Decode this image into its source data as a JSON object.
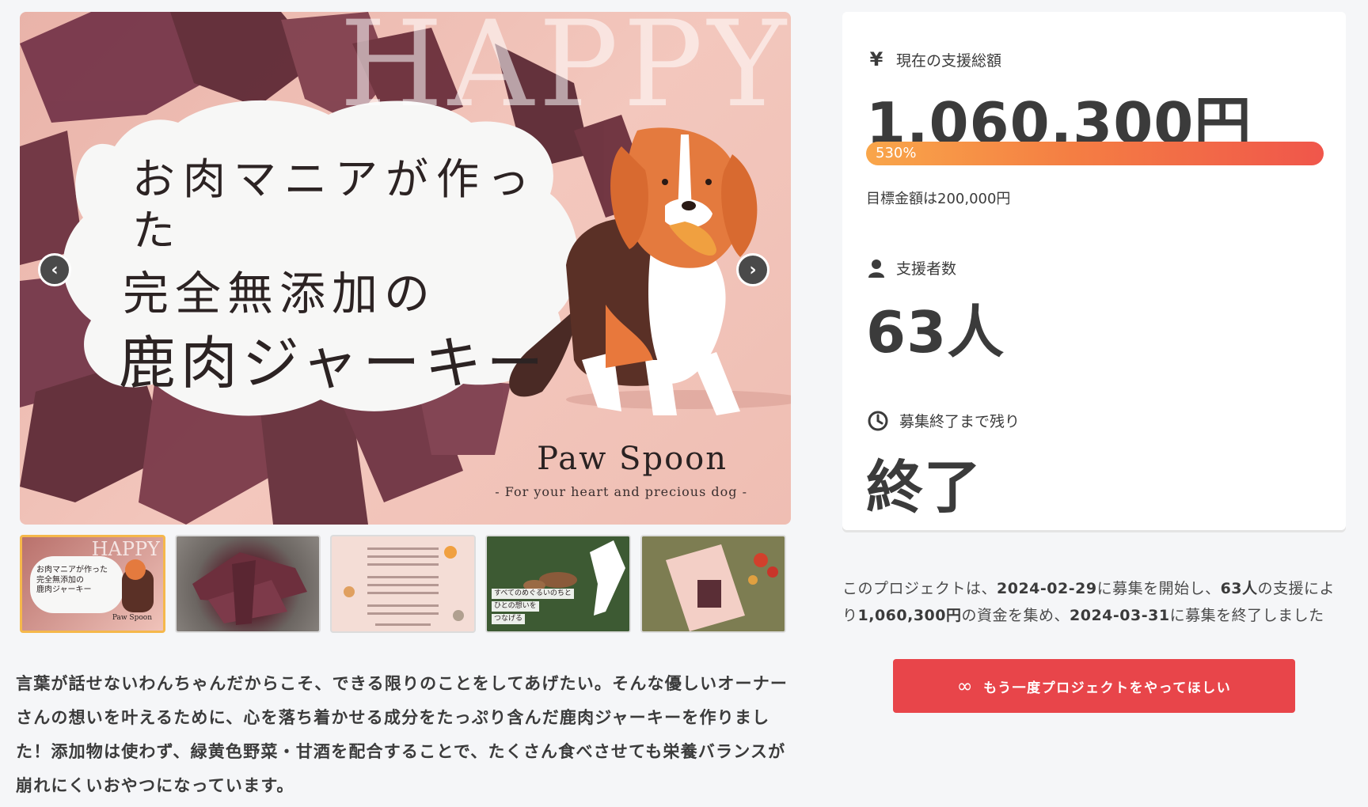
{
  "hero": {
    "happy_text": "HAPPY",
    "headline_line1": "お肉マニアが作った",
    "headline_line2": "完全無添加の",
    "headline_line3": "鹿肉ジャーキー",
    "brand": "Paw Spoon",
    "tagline": "- For your heart and precious dog -",
    "prev_icon": "chevron-left-icon",
    "next_icon": "chevron-right-icon"
  },
  "thumbnails": [
    {
      "id": "thumb-1",
      "happy": "HAPPY",
      "text": "お肉マニアが作った\n完全無添加の\n鹿肉ジャーキー",
      "brand": "Paw Spoon",
      "active": true
    },
    {
      "id": "thumb-2",
      "active": false
    },
    {
      "id": "thumb-3",
      "active": false
    },
    {
      "id": "thumb-4",
      "text1": "すべてのめぐるいのちと",
      "text2": "ひとの想いを",
      "text3": "つなげる",
      "active": false
    },
    {
      "id": "thumb-5",
      "active": false
    }
  ],
  "description": "言葉が話せないわんちゃんだからこそ、できる限りのことをしてあげたい。そんな優しいオーナーさんの想いを叶えるために、心を落ち着かせる成分をたっぷり含んだ鹿肉ジャーキーを作りました！添加物は使わず、緑黄色野菜・甘酒を配合することで、たくさん食べさせても栄養バランスが崩れにくいおやつになっています。",
  "stats": {
    "amount_icon": "yen-icon",
    "amount_label": "現在の支援総額",
    "amount_value": "1,060,300円",
    "progress_percent": 530,
    "progress_label": "530%",
    "goal_text": "目標金額は200,000円",
    "supporters_icon": "person-icon",
    "supporters_label": "支援者数",
    "supporters_value": "63人",
    "remaining_icon": "clock-icon",
    "remaining_label": "募集終了まで残り",
    "remaining_value": "終了"
  },
  "summary": {
    "part1": "このプロジェクトは、",
    "start_date": "2024-02-29",
    "part2": "に募集を開始し、",
    "supporters": "63人",
    "part3": "の支援により",
    "amount": "1,060,300円",
    "part4": "の資金を集め、",
    "end_date": "2024-03-31",
    "part5": "に募集を終了しました"
  },
  "cta": {
    "icon": "infinity-icon",
    "label": "もう一度プロジェクトをやってほしい"
  },
  "colors": {
    "accent": "#e8454a",
    "progress_start": "#f9a64a",
    "progress_end": "#f0564b",
    "active_thumb_border": "#f5b84b"
  }
}
